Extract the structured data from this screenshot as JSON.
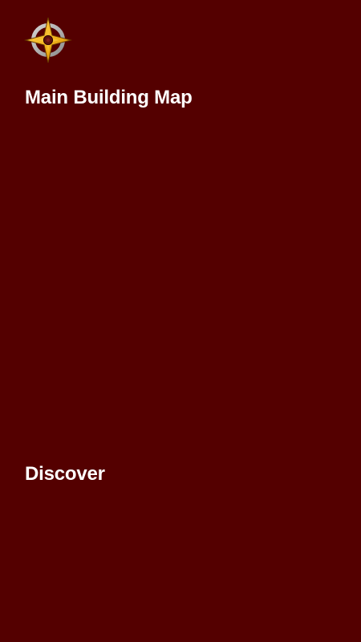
{
  "header": {
    "logo_icon": "compass-icon",
    "title": "Main Building Map"
  },
  "sections": {
    "discover_heading": "Discover"
  },
  "colors": {
    "background": "#540000",
    "text": "#ffffff",
    "logo_gold": "#f2b21b",
    "logo_ring": "#b7b7b7",
    "logo_center": "#5b1010"
  }
}
